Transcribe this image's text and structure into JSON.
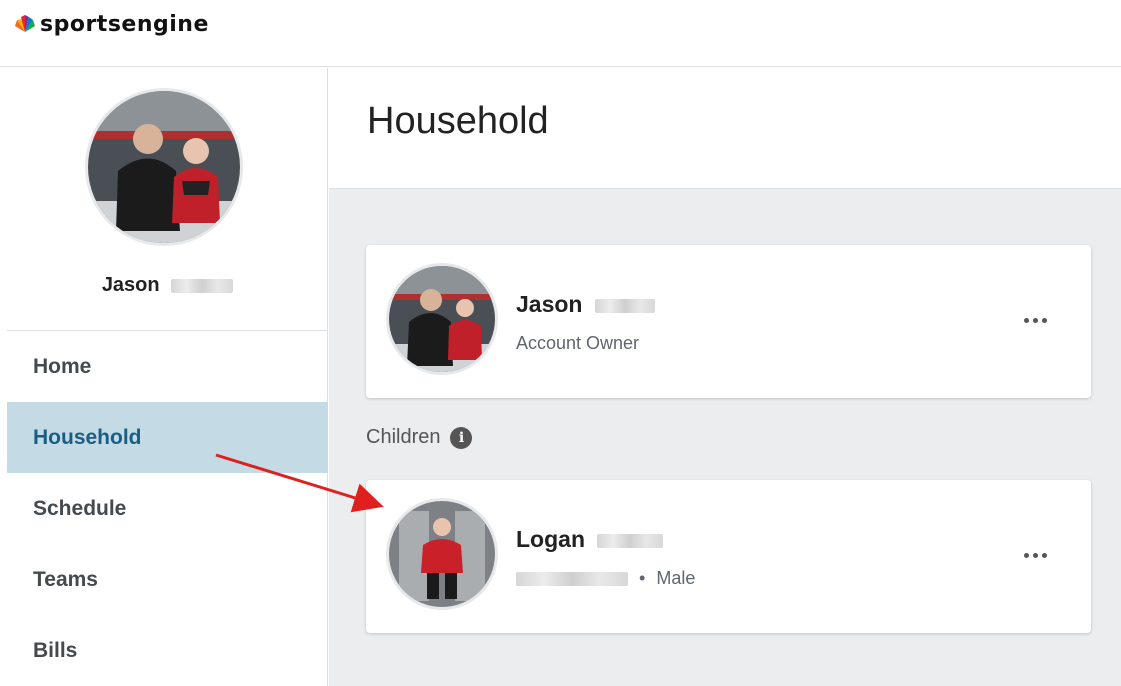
{
  "brand": {
    "logo_text": "sportsengine",
    "logo_icon": "nbc-peacock-icon"
  },
  "sidebar": {
    "profile_name": "Jason",
    "nav": [
      {
        "label": "Home",
        "active": false
      },
      {
        "label": "Household",
        "active": true
      },
      {
        "label": "Schedule",
        "active": false
      },
      {
        "label": "Teams",
        "active": false
      },
      {
        "label": "Bills",
        "active": false
      }
    ]
  },
  "main": {
    "title": "Household",
    "owner": {
      "name": "Jason",
      "role": "Account Owner"
    },
    "children_label": "Children",
    "children": [
      {
        "name": "Logan",
        "gender": "Male"
      }
    ]
  },
  "icons": {
    "more": "more-horizontal-icon",
    "info": "info-icon"
  },
  "colors": {
    "active_nav_bg": "#c4dbe6",
    "active_nav_text": "#1b5e84",
    "arrow": "#e01f1f"
  }
}
